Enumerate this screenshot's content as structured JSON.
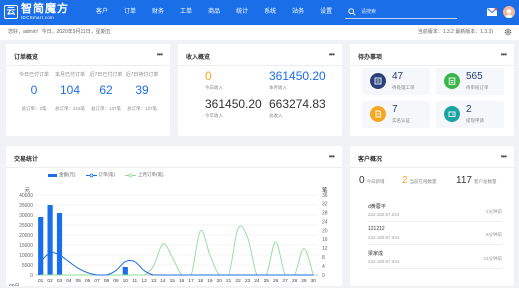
{
  "app": {
    "logo_mark": "云",
    "logo_text": "智简魔方",
    "logo_sub": "IDCSmart.com"
  },
  "nav": [
    "客户",
    "订单",
    "财务",
    "工单",
    "商品",
    "统计",
    "系统",
    "站务",
    "设置"
  ],
  "search": {
    "placeholder": "请搜索"
  },
  "subbar": {
    "greeting": "您好，admin！今日，2020年9月11日，星期五",
    "version": "当前版本：1.3.2    最新版本：1.3.3)"
  },
  "orders": {
    "title": "订单概览",
    "cols": [
      {
        "head": "今日已付订单",
        "value": "0",
        "foot": "总订单：2笔"
      },
      {
        "head": "本月已付订单",
        "value": "104",
        "foot": "总订单：216笔"
      },
      {
        "head": "近7日已付订单",
        "value": "62",
        "foot": "总订单：137笔"
      },
      {
        "head": "近7日待付订单",
        "value": "39",
        "foot": "总订单：137笔"
      }
    ]
  },
  "income": {
    "title": "收入概览",
    "today_value": "0",
    "today_label": "今日收入",
    "month_value": "361450.20",
    "month_label": "本月收入",
    "year_value": "361450.20",
    "year_label": "今年收入",
    "total_value": "663274.83",
    "total_label": "总收入"
  },
  "todo": {
    "title": "待办事项",
    "items": [
      {
        "num": "47",
        "label": "待处理工单",
        "color": "#2a3f7c"
      },
      {
        "num": "565",
        "label": "待审核订单",
        "color": "#39b54a"
      },
      {
        "num": "7",
        "label": "实名认证",
        "color": "#f5a623"
      },
      {
        "num": "2",
        "label": "提现申请",
        "color": "#1aa3a3"
      }
    ]
  },
  "trade": {
    "title": "交易统计",
    "legend": [
      "金额(元)",
      "订单(笔)",
      "上月订单(笔)"
    ]
  },
  "customers": {
    "title": "客户概况",
    "stats": [
      {
        "num": "0",
        "label": "今日新增",
        "color": "#333333"
      },
      {
        "num": "2",
        "label": "当前在线数量",
        "color": "#f5a623"
      },
      {
        "num": "117",
        "label": "客户总数量",
        "color": "#333333"
      }
    ],
    "rows": [
      {
        "name": "d黄蓉平",
        "ip": "222.182.57.244",
        "time": "1分钟前"
      },
      {
        "name": "121212",
        "ip": "222.182.57.244",
        "time": "8分钟前"
      },
      {
        "name": "梁家成",
        "ip": "222.182.57.244",
        "time": "21分钟前"
      }
    ]
  },
  "chart_data": {
    "type": "bar",
    "left_axis_label": "元",
    "right_axis_label": "笔",
    "y_ticks": [
      0,
      5000,
      10000,
      15000,
      20000,
      25000,
      30000,
      35000,
      40000
    ],
    "right_ticks": [
      0,
      4,
      8,
      12,
      16,
      20,
      24,
      28,
      32,
      36
    ],
    "categories": [
      "01",
      "02",
      "03",
      "04",
      "05",
      "06",
      "07",
      "08",
      "09",
      "10",
      "11",
      "12",
      "13",
      "14",
      "15",
      "16",
      "17",
      "18",
      "19",
      "20",
      "21",
      "22",
      "23",
      "24",
      "25",
      "26",
      "27",
      "28",
      "29",
      "30"
    ],
    "month_label": "09月",
    "ylim": [
      0,
      40000
    ],
    "right_ylim": [
      0,
      36
    ],
    "series": [
      {
        "name": "金额(元)",
        "type": "bar",
        "color": "#1a6fe8",
        "values": [
          29000,
          35000,
          31000,
          0,
          0,
          0,
          0,
          0,
          0,
          4000,
          0,
          0,
          0,
          0,
          0,
          0,
          0,
          0,
          0,
          0,
          0,
          0,
          0,
          0,
          0,
          0,
          0,
          0,
          0,
          0
        ]
      },
      {
        "name": "订单(笔)",
        "type": "line",
        "color": "#1a6fe8",
        "values": [
          6,
          10,
          9,
          6,
          3,
          1,
          0,
          0,
          2,
          6,
          6,
          2,
          0,
          0,
          0,
          0,
          0,
          0,
          0,
          0,
          0,
          0,
          0,
          0,
          0,
          0,
          0,
          0,
          0,
          0
        ]
      },
      {
        "name": "上月订单(笔)",
        "type": "line",
        "color": "#8fdc9a",
        "values": [
          0,
          0,
          0,
          0,
          0,
          0,
          0,
          0,
          0,
          0,
          0,
          0,
          4,
          14,
          8,
          0,
          0,
          20,
          9,
          0,
          0,
          21,
          17,
          0,
          0,
          15,
          0,
          0,
          12,
          0
        ]
      }
    ]
  }
}
